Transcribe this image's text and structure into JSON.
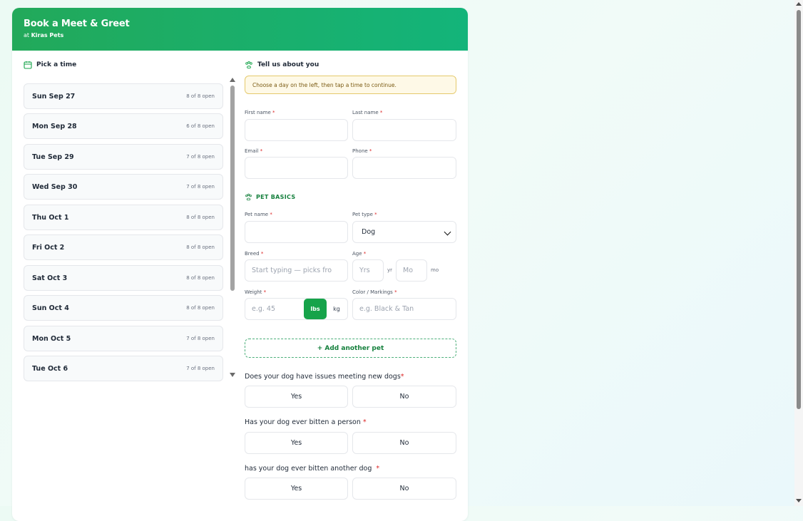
{
  "header": {
    "title": "Book a Meet & Greet",
    "sub_prefix": "at",
    "business": "Kiras Pets"
  },
  "colors": {
    "accent": "#16a34a",
    "header_start": "#22a95a",
    "header_end": "#13b47a",
    "notice_bg": "#fef9e7",
    "required": "#dc2626"
  },
  "left": {
    "heading": "Pick a time",
    "heading_icon": "calendar-icon",
    "days": [
      {
        "label": "Sun Sep 27",
        "open": "8 of 8 open"
      },
      {
        "label": "Mon Sep 28",
        "open": "6 of 8 open"
      },
      {
        "label": "Tue Sep 29",
        "open": "7 of 8 open"
      },
      {
        "label": "Wed Sep 30",
        "open": "7 of 8 open"
      },
      {
        "label": "Thu Oct 1",
        "open": "8 of 8 open"
      },
      {
        "label": "Fri Oct 2",
        "open": "8 of 8 open"
      },
      {
        "label": "Sat Oct 3",
        "open": "8 of 8 open"
      },
      {
        "label": "Sun Oct 4",
        "open": "8 of 8 open"
      },
      {
        "label": "Mon Oct 5",
        "open": "7 of 8 open"
      },
      {
        "label": "Tue Oct 6",
        "open": "7 of 8 open"
      }
    ]
  },
  "right": {
    "heading": "Tell us about you",
    "heading_icon": "paw-icon",
    "notice": "Choose a day on the left, then tap a time to continue.",
    "required_mark": "*",
    "fields": {
      "first_name": "First name",
      "last_name": "Last name",
      "email": "Email",
      "phone": "Phone"
    },
    "pet_basics": {
      "heading": "PET BASICS",
      "pet_name": "Pet name",
      "pet_type": "Pet type",
      "pet_type_value": "Dog",
      "breed": "Breed",
      "breed_placeholder": "Start typing — picks fro",
      "age": "Age",
      "age_years_placeholder": "Yrs",
      "age_years_unit": "yr",
      "age_months_placeholder": "Mo",
      "age_months_unit": "mo",
      "weight": "Weight",
      "weight_placeholder": "e.g. 45",
      "unit_lbs": "lbs",
      "unit_kg": "kg",
      "color": "Color / Markings",
      "color_placeholder": "e.g. Black & Tan"
    },
    "add_pet": "+ Add another pet",
    "questions": [
      {
        "text": "Does your dog have issues meeting new dogs",
        "yes": "Yes",
        "no": "No"
      },
      {
        "text": "Has your dog ever bitten a person",
        "yes": "Yes",
        "no": "No"
      },
      {
        "text": "has your dog ever bitten another dog ",
        "yes": "Yes",
        "no": "No"
      }
    ]
  }
}
